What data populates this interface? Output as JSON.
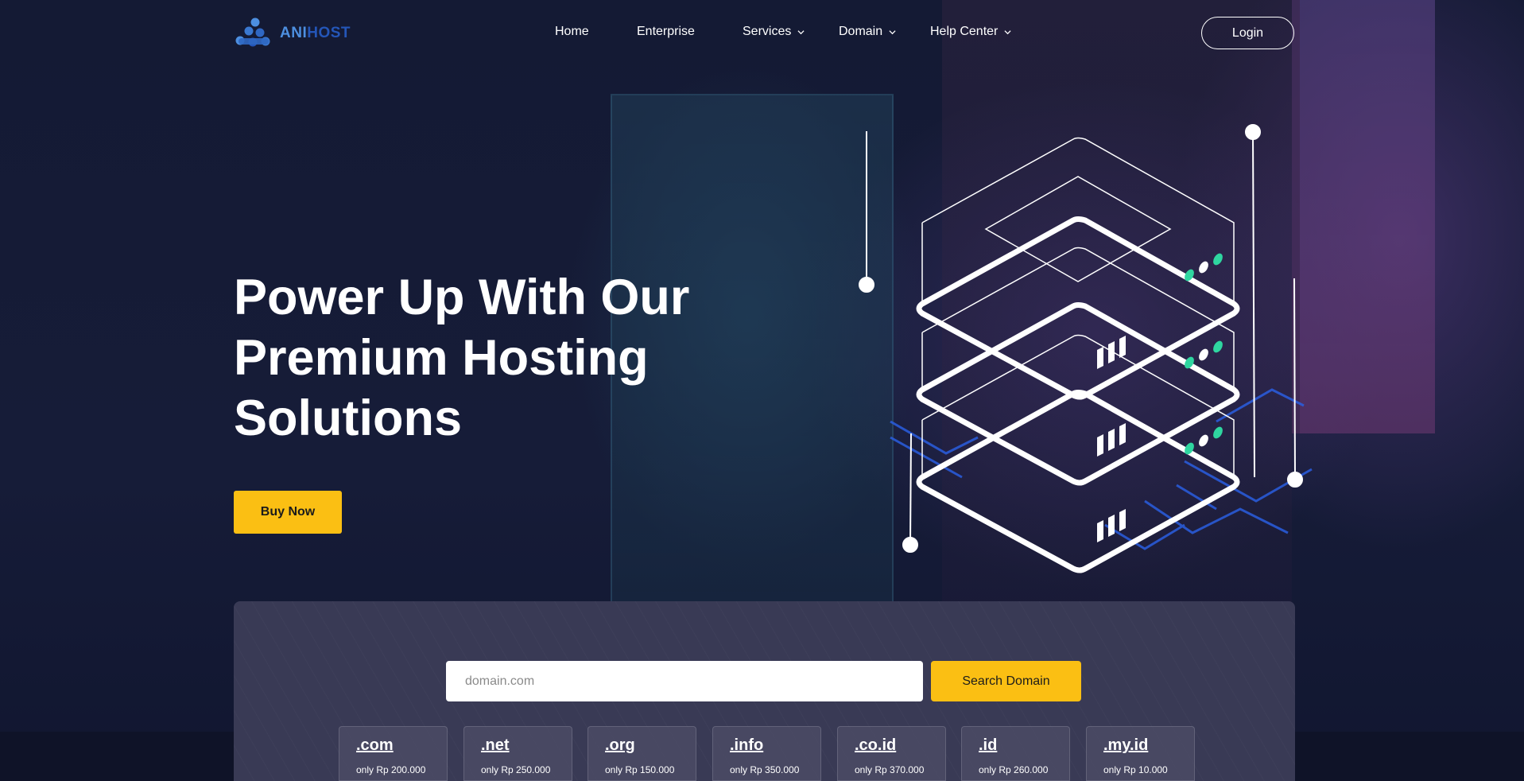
{
  "brand": {
    "name_part1": "ANI",
    "name_part2": "HOST"
  },
  "nav": {
    "items": [
      {
        "label": "Home",
        "has_dropdown": false
      },
      {
        "label": "Enterprise",
        "has_dropdown": false
      },
      {
        "label": "Services",
        "has_dropdown": true
      },
      {
        "label": "Domain",
        "has_dropdown": true
      },
      {
        "label": "Help Center",
        "has_dropdown": true
      }
    ],
    "login_label": "Login"
  },
  "hero": {
    "title_line1": "Power Up With Our",
    "title_line2": "Premium Hosting",
    "title_line3": "Solutions",
    "cta_label": "Buy Now"
  },
  "domain_search": {
    "placeholder": "domain.com",
    "button_label": "Search Domain",
    "tlds": [
      {
        "name": ".com",
        "price": "only Rp 200.000"
      },
      {
        "name": ".net",
        "price": "only Rp 250.000"
      },
      {
        "name": ".org",
        "price": "only Rp 150.000"
      },
      {
        "name": ".info",
        "price": "only Rp 350.000"
      },
      {
        "name": ".co.id",
        "price": "only Rp 370.000"
      },
      {
        "name": ".id",
        "price": "only Rp 260.000"
      },
      {
        "name": ".my.id",
        "price": "only Rp 10.000"
      }
    ]
  },
  "colors": {
    "accent": "#fbbf13",
    "background": "#141a34",
    "panel": "#393a55",
    "logo_light": "#4d8fe0",
    "logo_dark": "#2456b8",
    "server_leds": "#2fd6a0"
  },
  "icons": [
    "logo-icon",
    "chevron-down-icon",
    "server-stack-illustration"
  ]
}
